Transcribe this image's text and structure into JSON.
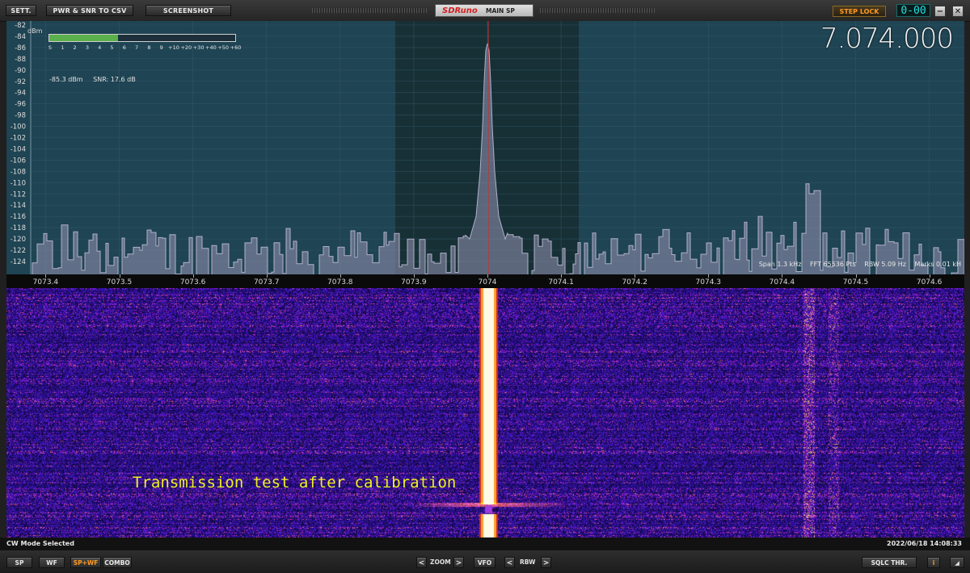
{
  "toolbar": {
    "sett": "SETT.",
    "pwr_snr": "PWR & SNR TO CSV",
    "screenshot": "SCREENSHOT",
    "brand": "SDRuno",
    "main_sp": "MAIN SP",
    "step_lock": "STEP LOCK",
    "counter": "0-00",
    "minimize": "−",
    "close": "✕"
  },
  "spectrum": {
    "frequency": "7.074.000",
    "dbm_unit": "dBm",
    "level": "-85.3 dBm",
    "snr": "SNR: 17.6 dB",
    "span": "Span 1.3 kHz",
    "fft": "FFT 65536 Pts",
    "rbw": "RBW 5.09 Hz",
    "marks": "Marks 0.01 kH",
    "smeter_fraction": 0.37,
    "smeter_labels": [
      "S",
      "1",
      "2",
      "3",
      "4",
      "5",
      "6",
      "7",
      "8",
      "9",
      "+10",
      "+20",
      "+30",
      "+40",
      "+50",
      "+60"
    ],
    "y_ticks": [
      "-82",
      "-84",
      "-86",
      "-88",
      "-90",
      "-92",
      "-94",
      "-96",
      "-98",
      "-100",
      "-102",
      "-104",
      "-106",
      "-108",
      "-110",
      "-112",
      "-114",
      "-116",
      "-118",
      "-120",
      "-122",
      "-124"
    ],
    "x_ticks": [
      "7073.4",
      "7073.5",
      "7073.6",
      "7073.7",
      "7073.8",
      "7073.9",
      "7074",
      "7074.1",
      "7074.2",
      "7074.3",
      "7074.4",
      "7074.5",
      "7074.6"
    ],
    "colors": {
      "background": "#1f4453",
      "filter": "#173036",
      "trace": "#b0b0c8",
      "fill": "#8c8caa",
      "cursor": "#c43030"
    }
  },
  "waterfall": {
    "annotation": "Transmission test after calibration"
  },
  "status": {
    "mode": "CW Mode Selected",
    "timestamp": "2022/06/18 14:08:33"
  },
  "bottom": {
    "sp": "SP",
    "wf": "WF",
    "sp_wf": "SP+WF",
    "combo": "COMBO",
    "zoom": "ZOOM",
    "vfo": "VFO",
    "rbw": "RBW",
    "prev": "<",
    "next": ">",
    "sqlc": "SQLC THR.",
    "info": "i",
    "resize": "◢"
  }
}
